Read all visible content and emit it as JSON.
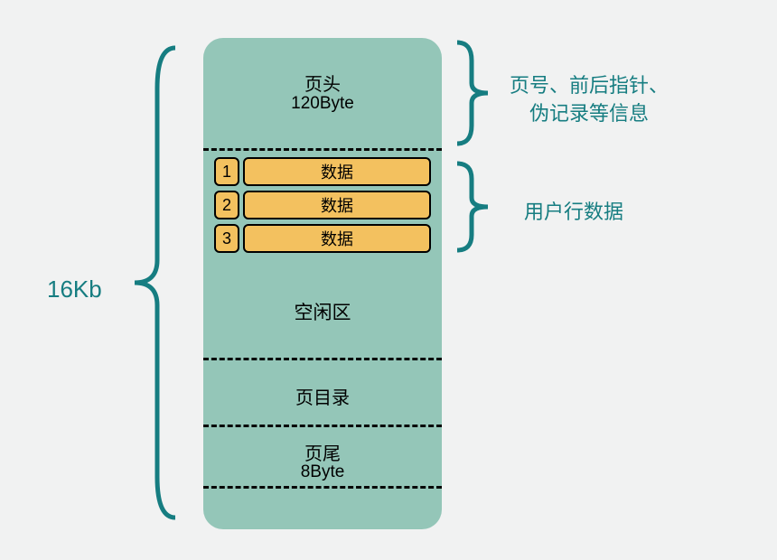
{
  "leftLabel": "16Kb",
  "header": {
    "title": "页头",
    "size": "120Byte"
  },
  "rows": [
    {
      "num": "1",
      "label": "数据"
    },
    {
      "num": "2",
      "label": "数据"
    },
    {
      "num": "3",
      "label": "数据"
    }
  ],
  "freeArea": "空闲区",
  "pageDir": "页目录",
  "footer": {
    "title": "页尾",
    "size": "8Byte"
  },
  "rightLabel1a": "页号、前后指针、",
  "rightLabel1b": "伪记录等信息",
  "rightLabel2": "用户行数据",
  "colors": {
    "block": "#94c6b8",
    "row": "#f3c15f",
    "text": "#167d81"
  }
}
